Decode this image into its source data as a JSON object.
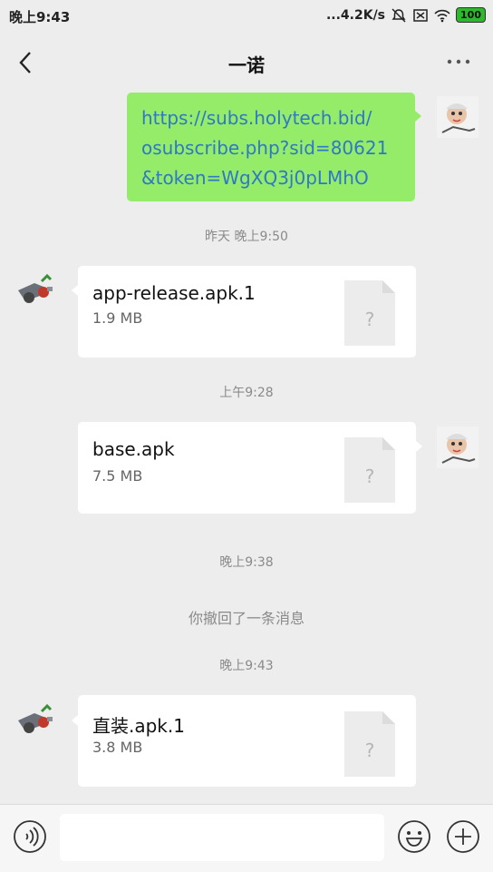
{
  "status_bar": {
    "time": "晚上9:43",
    "network_speed": "...4.2K/s",
    "battery": "100",
    "icons": [
      "dnd-off-icon",
      "sim-off-icon",
      "wifi-icon",
      "battery-icon"
    ]
  },
  "header": {
    "title": "一诺",
    "back_icon": "chevron-left-icon",
    "more_icon": "more-dots-icon"
  },
  "messages": [
    {
      "side": "right",
      "type": "text",
      "lines": [
        "https://subs.holytech.bid/",
        "osubscribe.php?sid=80621",
        "&token=WgXQ3j0pLMhO"
      ]
    },
    {
      "type": "timestamp",
      "text": "昨天 晚上9:50"
    },
    {
      "side": "left",
      "type": "file",
      "name": "app-release.apk.1",
      "size": "1.9 MB",
      "icon": "unknown-file-icon"
    },
    {
      "type": "timestamp",
      "text": "上午9:28"
    },
    {
      "side": "right",
      "type": "file",
      "name": "base.apk",
      "size": "7.5 MB",
      "icon": "unknown-file-icon"
    },
    {
      "type": "timestamp",
      "text": "晚上9:38"
    },
    {
      "type": "system",
      "text": "你撤回了一条消息"
    },
    {
      "type": "timestamp",
      "text": "晚上9:43"
    },
    {
      "side": "left",
      "type": "file",
      "name": "直装.apk.1",
      "size": "3.8 MB",
      "icon": "unknown-file-icon"
    }
  ],
  "input_bar": {
    "voice_icon": "voice-icon",
    "input_value": "",
    "emoji_icon": "emoji-icon",
    "plus_icon": "plus-icon"
  },
  "colors": {
    "background": "#ededed",
    "sent_bubble": "#95ec69",
    "received_bubble": "#ffffff",
    "link": "#2e78c8",
    "meta_text": "#8a8a8a"
  }
}
